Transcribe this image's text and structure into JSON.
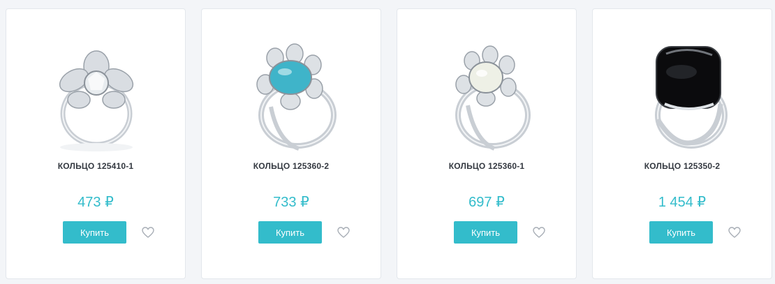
{
  "products": [
    {
      "title": "КОЛЬЦО 125410-1",
      "price": "473 ₽",
      "buy_label": "Купить",
      "stone": "clear crystal",
      "stone_color": "#e8ecef"
    },
    {
      "title": "КОЛЬЦО 125360-2",
      "price": "733 ₽",
      "buy_label": "Купить",
      "stone": "turquoise",
      "stone_color": "#3fb4c9"
    },
    {
      "title": "КОЛЬЦО 125360-1",
      "price": "697 ₽",
      "buy_label": "Купить",
      "stone": "moonstone",
      "stone_color": "#eef0e6"
    },
    {
      "title": "КОЛЬЦО 125350-2",
      "price": "1 454 ₽",
      "buy_label": "Купить",
      "stone": "black onyx",
      "stone_color": "#0b0b0d"
    }
  ],
  "colors": {
    "accent": "#33bccb",
    "heart": "#a7adb5",
    "metal": "#c9ced4"
  },
  "icons": {
    "favorite": "heart-outline-icon"
  }
}
